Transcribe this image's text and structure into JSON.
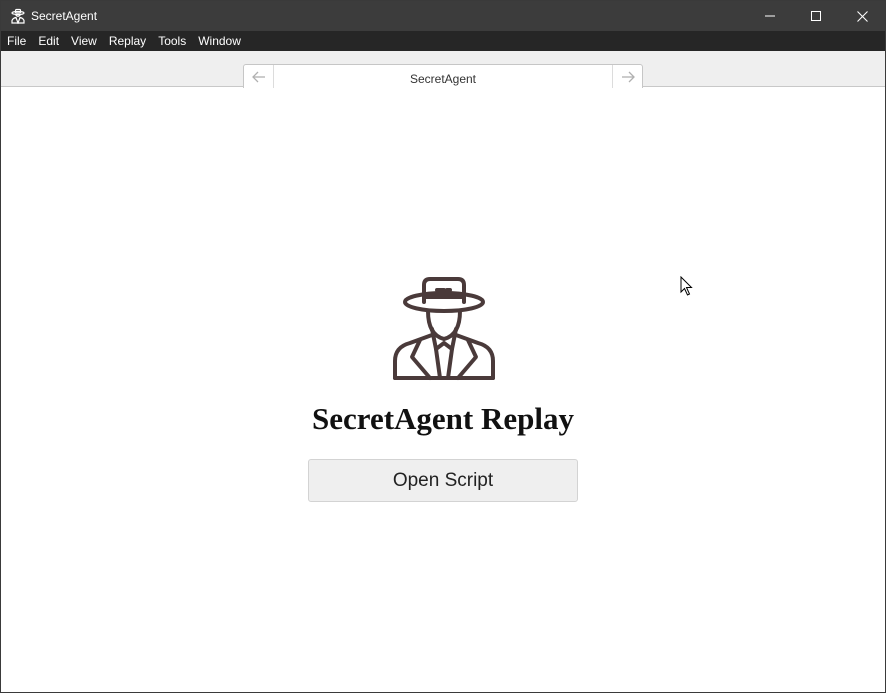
{
  "window": {
    "title": "SecretAgent",
    "icons": {
      "app": "spy-agent-icon",
      "minimize": "minimize-icon",
      "maximize": "maximize-icon",
      "close": "close-icon"
    }
  },
  "menubar": {
    "items": [
      {
        "label": "File"
      },
      {
        "label": "Edit"
      },
      {
        "label": "View"
      },
      {
        "label": "Replay"
      },
      {
        "label": "Tools"
      },
      {
        "label": "Window"
      }
    ]
  },
  "toolbar": {
    "url_text": "SecretAgent",
    "back_icon": "arrow-left-icon",
    "forward_icon": "arrow-right-icon"
  },
  "main": {
    "logo_icon": "spy-agent-icon",
    "heading": "SecretAgent Replay",
    "open_button_label": "Open Script"
  },
  "colors": {
    "titlebar_bg": "#3c3c3c",
    "menubar_bg": "#262626",
    "toolbar_bg": "#efefef",
    "logo_stroke": "#4a3a3a",
    "button_bg": "#efefef"
  }
}
